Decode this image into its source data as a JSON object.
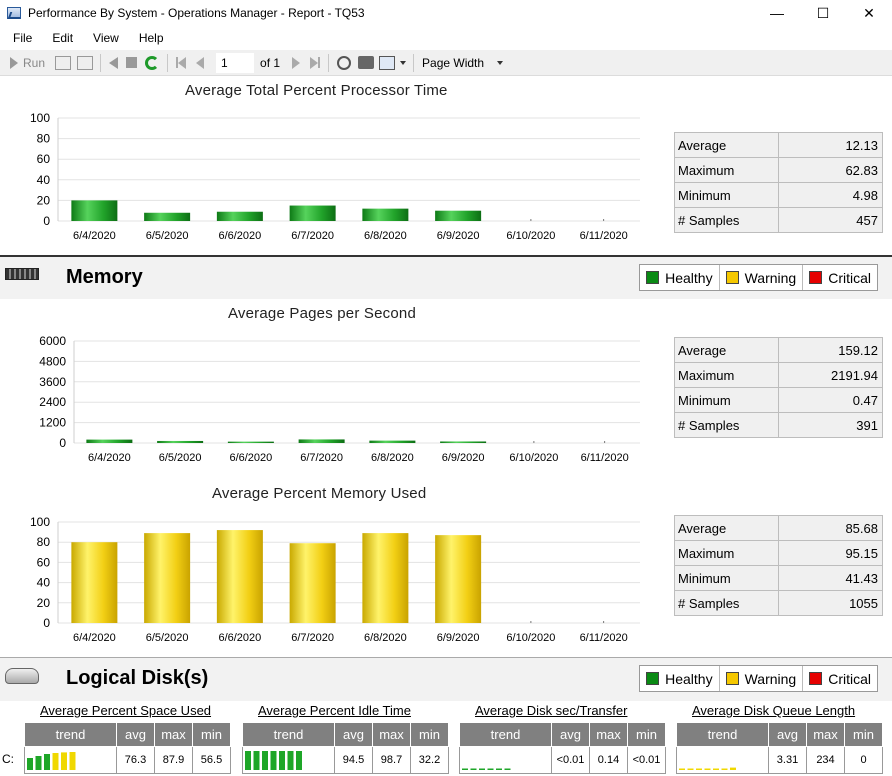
{
  "window": {
    "title": "Performance By System - Operations Manager - Report - TQ53",
    "minimize": "—",
    "maximize": "☐",
    "close": "✕"
  },
  "menu": [
    "File",
    "Edit",
    "View",
    "Help"
  ],
  "toolbar": {
    "run_label": "Run",
    "page_value": "1",
    "of_label": "of 1",
    "zoom_value": "Page Width"
  },
  "colors": {
    "healthy": "#0a8a14",
    "warning": "#f5c800",
    "critical": "#e60000",
    "bar_green": "#21a32a",
    "bar_yellow": "#f2cf14"
  },
  "processor": {
    "chart_data": {
      "type": "bar",
      "title": "Average Total Percent Processor Time",
      "categories": [
        "6/4/2020",
        "6/5/2020",
        "6/6/2020",
        "6/7/2020",
        "6/8/2020",
        "6/9/2020",
        "6/10/2020",
        "6/11/2020"
      ],
      "values": [
        20,
        8,
        9,
        15,
        12,
        10,
        null,
        null
      ],
      "yticks": [
        0,
        20,
        40,
        60,
        80,
        100
      ],
      "ylim": [
        0,
        100
      ],
      "color": "green"
    },
    "stats": [
      {
        "label": "Average",
        "value": "12.13"
      },
      {
        "label": "Maximum",
        "value": "62.83"
      },
      {
        "label": "Minimum",
        "value": "4.98"
      },
      {
        "label": "# Samples",
        "value": "457"
      }
    ]
  },
  "memory": {
    "title": "Memory",
    "legend": {
      "healthy": "Healthy",
      "warning": "Warning",
      "critical": "Critical"
    },
    "pages": {
      "chart_data": {
        "type": "bar",
        "title": "Average Pages per Second",
        "categories": [
          "6/4/2020",
          "6/5/2020",
          "6/6/2020",
          "6/7/2020",
          "6/8/2020",
          "6/9/2020",
          "6/10/2020",
          "6/11/2020"
        ],
        "values": [
          200,
          120,
          80,
          210,
          140,
          90,
          null,
          null
        ],
        "yticks": [
          0,
          1200,
          2400,
          3600,
          4800,
          6000
        ],
        "ylim": [
          0,
          6000
        ],
        "color": "green"
      },
      "stats": [
        {
          "label": "Average",
          "value": "159.12"
        },
        {
          "label": "Maximum",
          "value": "2191.94"
        },
        {
          "label": "Minimum",
          "value": "0.47"
        },
        {
          "label": "# Samples",
          "value": "391"
        }
      ]
    },
    "used": {
      "chart_data": {
        "type": "bar",
        "title": "Average Percent Memory Used",
        "categories": [
          "6/4/2020",
          "6/5/2020",
          "6/6/2020",
          "6/7/2020",
          "6/8/2020",
          "6/9/2020",
          "6/10/2020",
          "6/11/2020"
        ],
        "values": [
          80,
          89,
          92,
          79,
          89,
          87,
          null,
          null
        ],
        "yticks": [
          0,
          20,
          40,
          60,
          80,
          100
        ],
        "ylim": [
          0,
          100
        ],
        "color": "yellow"
      },
      "stats": [
        {
          "label": "Average",
          "value": "85.68"
        },
        {
          "label": "Maximum",
          "value": "95.15"
        },
        {
          "label": "Minimum",
          "value": "41.43"
        },
        {
          "label": "# Samples",
          "value": "1055"
        }
      ]
    }
  },
  "disk": {
    "title": "Logical Disk(s)",
    "legend": {
      "healthy": "Healthy",
      "warning": "Warning",
      "critical": "Critical"
    },
    "drive": "C:",
    "headers": {
      "trend": "trend",
      "avg": "avg",
      "max": "max",
      "min": "min"
    },
    "blocks": [
      {
        "title": "Average Percent Space Used",
        "avg": "76.3",
        "max": "87.9",
        "min": "56.5",
        "trend": [
          {
            "v": 0.6,
            "c": "green"
          },
          {
            "v": 0.7,
            "c": "green"
          },
          {
            "v": 0.8,
            "c": "green"
          },
          {
            "v": 0.85,
            "c": "yellow"
          },
          {
            "v": 0.88,
            "c": "yellow"
          },
          {
            "v": 0.9,
            "c": "yellow"
          }
        ]
      },
      {
        "title": "Average Percent Idle Time",
        "avg": "94.5",
        "max": "98.7",
        "min": "32.2",
        "trend": [
          {
            "v": 0.95,
            "c": "green"
          },
          {
            "v": 0.95,
            "c": "green"
          },
          {
            "v": 0.95,
            "c": "green"
          },
          {
            "v": 0.95,
            "c": "green"
          },
          {
            "v": 0.95,
            "c": "green"
          },
          {
            "v": 0.95,
            "c": "green"
          },
          {
            "v": 0.95,
            "c": "green"
          }
        ]
      },
      {
        "title": "Average Disk sec/Transfer",
        "avg": "<0.01",
        "max": "0.14",
        "min": "<0.01",
        "trend": [
          {
            "v": 0.03,
            "c": "green"
          },
          {
            "v": 0.03,
            "c": "green"
          },
          {
            "v": 0.03,
            "c": "green"
          },
          {
            "v": 0.03,
            "c": "green"
          },
          {
            "v": 0.03,
            "c": "green"
          },
          {
            "v": 0.03,
            "c": "green"
          }
        ]
      },
      {
        "title": "Average Disk Queue Length",
        "avg": "3.31",
        "max": "234",
        "min": "0",
        "trend": [
          {
            "v": 0.03,
            "c": "yellow"
          },
          {
            "v": 0.03,
            "c": "yellow"
          },
          {
            "v": 0.03,
            "c": "yellow"
          },
          {
            "v": 0.03,
            "c": "yellow"
          },
          {
            "v": 0.03,
            "c": "yellow"
          },
          {
            "v": 0.03,
            "c": "yellow"
          },
          {
            "v": 0.12,
            "c": "yellow"
          }
        ]
      }
    ]
  }
}
